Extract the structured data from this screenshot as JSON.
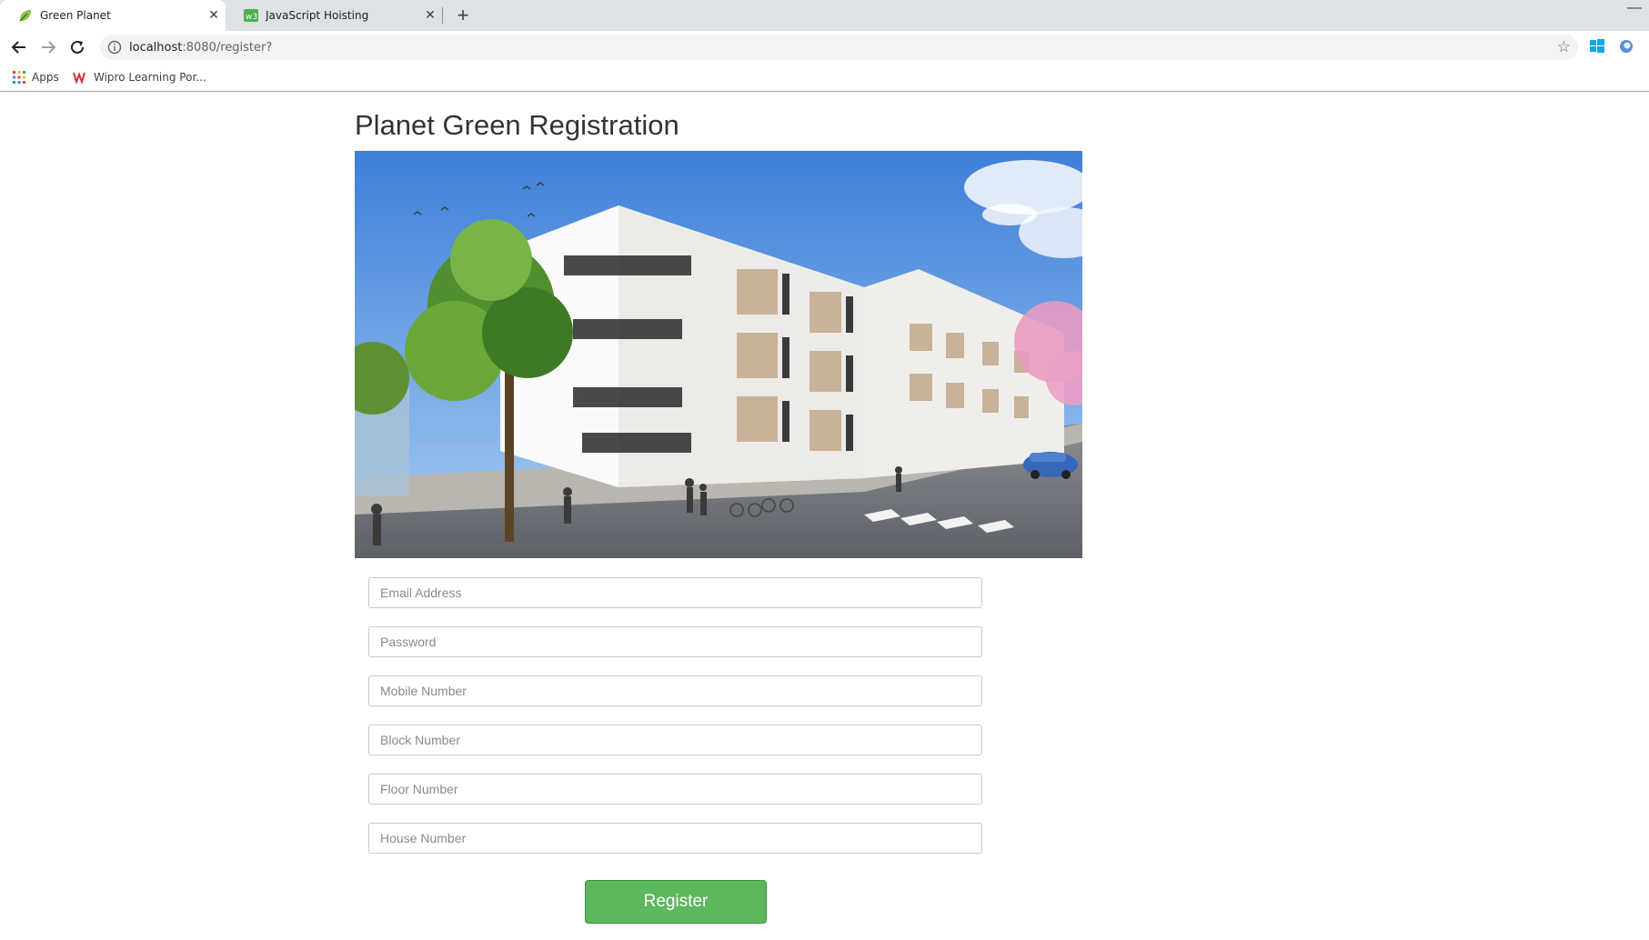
{
  "browser": {
    "tabs": [
      {
        "title": "Green Planet",
        "active": true,
        "favicon": "leaf-icon"
      },
      {
        "title": "JavaScript Hoisting",
        "active": false,
        "favicon": "w3-icon"
      }
    ],
    "address": {
      "host": "localhost",
      "path": ":8080/register?"
    },
    "bookmarks": [
      {
        "label": "Apps",
        "icon": "apps-grid-icon"
      },
      {
        "label": "Wipro Learning Por...",
        "icon": "wipro-icon"
      }
    ]
  },
  "page": {
    "title": "Planet Green Registration",
    "hero_image": "apartment-building-illustration"
  },
  "form": {
    "email_placeholder": "Email Address",
    "password_placeholder": "Password",
    "mobile_placeholder": "Mobile Number",
    "block_placeholder": "Block Number",
    "floor_placeholder": "Floor Number",
    "house_placeholder": "House Number",
    "register_label": "Register"
  },
  "colors": {
    "register_button": "#5cb85c",
    "tabstrip": "#dee1e6"
  }
}
